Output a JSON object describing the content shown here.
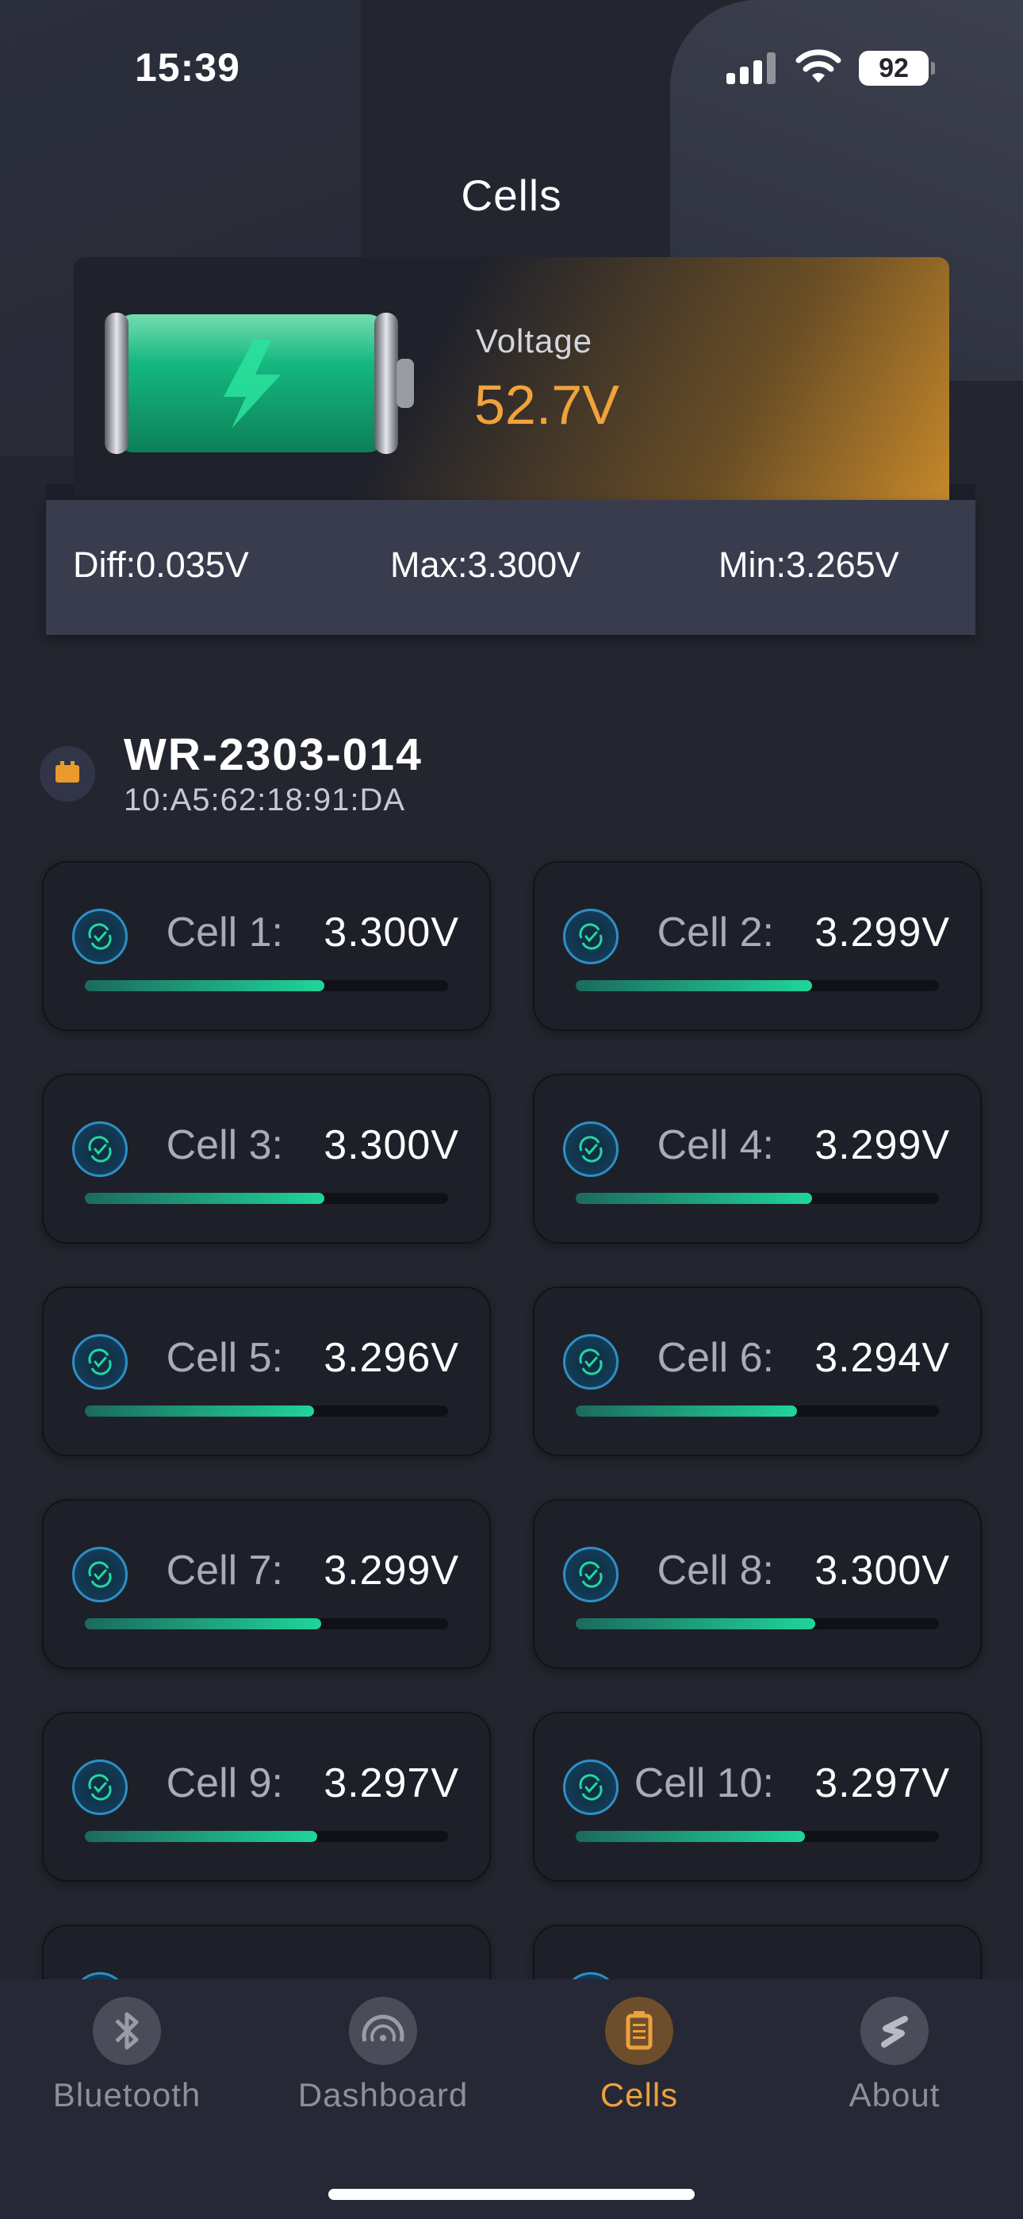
{
  "status_bar": {
    "time": "15:39",
    "battery": "92"
  },
  "header": {
    "title": "Cells"
  },
  "summary": {
    "voltage_label": "Voltage",
    "voltage_value": "52.7V",
    "diff": "Diff:0.035V",
    "max": "Max:3.300V",
    "min": "Min:3.265V"
  },
  "device": {
    "name": "WR-2303-014",
    "mac": "10:A5:62:18:91:DA"
  },
  "cells": [
    {
      "label": "Cell 1:",
      "value": "3.300V",
      "level": 0.66
    },
    {
      "label": "Cell 2:",
      "value": "3.299V",
      "level": 0.65
    },
    {
      "label": "Cell 3:",
      "value": "3.300V",
      "level": 0.66
    },
    {
      "label": "Cell 4:",
      "value": "3.299V",
      "level": 0.65
    },
    {
      "label": "Cell 5:",
      "value": "3.296V",
      "level": 0.63
    },
    {
      "label": "Cell 6:",
      "value": "3.294V",
      "level": 0.61
    },
    {
      "label": "Cell 7:",
      "value": "3.299V",
      "level": 0.65
    },
    {
      "label": "Cell 8:",
      "value": "3.300V",
      "level": 0.66
    },
    {
      "label": "Cell 9:",
      "value": "3.297V",
      "level": 0.64
    },
    {
      "label": "Cell 10:",
      "value": "3.297V",
      "level": 0.63
    }
  ],
  "tabs": [
    {
      "label": "Bluetooth",
      "icon": "bluetooth-icon"
    },
    {
      "label": "Dashboard",
      "icon": "gauge-icon"
    },
    {
      "label": "Cells",
      "icon": "battery-icon"
    },
    {
      "label": "About",
      "icon": "about-logo-icon"
    }
  ],
  "colors": {
    "accent": "#EEA03D",
    "cell_fill": "#1FD59A",
    "background": "#23252F"
  }
}
